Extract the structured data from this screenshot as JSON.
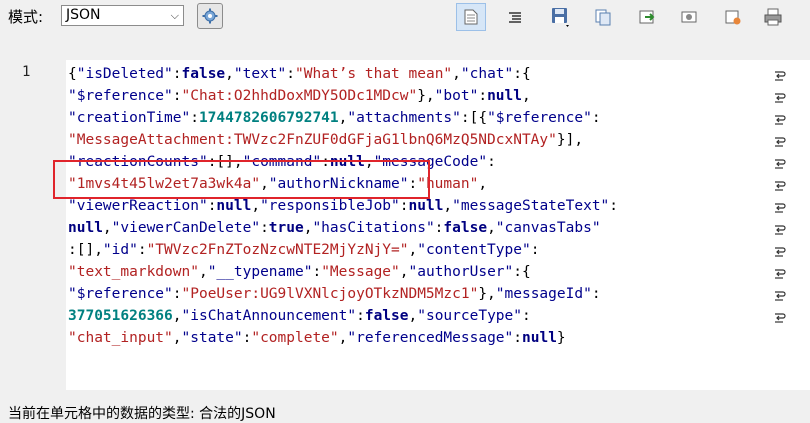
{
  "toolbar": {
    "mode_label": "模式:",
    "mode_value": "JSON",
    "buttons": [
      "format-icon",
      "compact-icon",
      "save-icon",
      "copy-icon",
      "export-icon",
      "image-icon",
      "record-icon",
      "print-icon"
    ]
  },
  "editor": {
    "line_number": "1",
    "lines": [
      [
        [
          "p",
          "{"
        ],
        [
          "k",
          "\"isDeleted\""
        ],
        [
          "p",
          ":"
        ],
        [
          "kw",
          "false"
        ],
        [
          "p",
          ","
        ],
        [
          "k",
          "\"text\""
        ],
        [
          "p",
          ":"
        ],
        [
          "s",
          "\"What’s that mean\""
        ],
        [
          "p",
          ","
        ],
        [
          "k",
          "\"chat\""
        ],
        [
          "p",
          ":{"
        ]
      ],
      [
        [
          "k",
          "\"$reference\""
        ],
        [
          "p",
          ":"
        ],
        [
          "s",
          "\"Chat:O2hhdDoxMDY5ODc1MDcw\""
        ],
        [
          "p",
          "},"
        ],
        [
          "k",
          "\"bot\""
        ],
        [
          "p",
          ":"
        ],
        [
          "kw",
          "null"
        ],
        [
          "p",
          ","
        ]
      ],
      [
        [
          "k",
          "\"creationTime\""
        ],
        [
          "p",
          ":"
        ],
        [
          "n",
          "1744782606792741"
        ],
        [
          "p",
          ","
        ],
        [
          "k",
          "\"attachments\""
        ],
        [
          "p",
          ":[{"
        ],
        [
          "k",
          "\"$reference\""
        ],
        [
          "p",
          ":"
        ]
      ],
      [
        [
          "s",
          "\"MessageAttachment:TWVzc2FnZUF0dGFjaG1lbnQ6MzQ5NDcxNTAy\""
        ],
        [
          "p",
          "}],"
        ]
      ],
      [
        [
          "k",
          "\"reactionCounts\""
        ],
        [
          "p",
          ":[],"
        ],
        [
          "k",
          "\"command\""
        ],
        [
          "p",
          ":"
        ],
        [
          "kw",
          "null"
        ],
        [
          "p",
          ","
        ],
        [
          "k",
          "\"messageCode\""
        ],
        [
          "p",
          ":"
        ]
      ],
      [
        [
          "s",
          "\"1mvs4t45lw2et7a3wk4a\""
        ],
        [
          "p",
          ","
        ],
        [
          "k",
          "\"authorNickname\""
        ],
        [
          "p",
          ":"
        ],
        [
          "s",
          "\"human\""
        ],
        [
          "p",
          ","
        ]
      ],
      [
        [
          "k",
          "\"viewerReaction\""
        ],
        [
          "p",
          ":"
        ],
        [
          "kw",
          "null"
        ],
        [
          "p",
          ","
        ],
        [
          "k",
          "\"responsibleJob\""
        ],
        [
          "p",
          ":"
        ],
        [
          "kw",
          "null"
        ],
        [
          "p",
          ","
        ],
        [
          "k",
          "\"messageStateText\""
        ],
        [
          "p",
          ":"
        ]
      ],
      [
        [
          "kw",
          "null"
        ],
        [
          "p",
          ","
        ],
        [
          "k",
          "\"viewerCanDelete\""
        ],
        [
          "p",
          ":"
        ],
        [
          "kw",
          "true"
        ],
        [
          "p",
          ","
        ],
        [
          "k",
          "\"hasCitations\""
        ],
        [
          "p",
          ":"
        ],
        [
          "kw",
          "false"
        ],
        [
          "p",
          ","
        ],
        [
          "k",
          "\"canvasTabs\""
        ]
      ],
      [
        [
          "p",
          ":[],"
        ],
        [
          "k",
          "\"id\""
        ],
        [
          "p",
          ":"
        ],
        [
          "s",
          "\"TWVzc2FnZTozNzcwNTE2MjYzNjY=\""
        ],
        [
          "p",
          ","
        ],
        [
          "k",
          "\"contentType\""
        ],
        [
          "p",
          ":"
        ]
      ],
      [
        [
          "s",
          "\"text_markdown\""
        ],
        [
          "p",
          ","
        ],
        [
          "k",
          "\"__typename\""
        ],
        [
          "p",
          ":"
        ],
        [
          "s",
          "\"Message\""
        ],
        [
          "p",
          ","
        ],
        [
          "k",
          "\"authorUser\""
        ],
        [
          "p",
          ":{"
        ]
      ],
      [
        [
          "k",
          "\"$reference\""
        ],
        [
          "p",
          ":"
        ],
        [
          "s",
          "\"PoeUser:UG9lVXNlcjoyOTkzNDM5Mzc1\""
        ],
        [
          "p",
          "},"
        ],
        [
          "k",
          "\"messageId\""
        ],
        [
          "p",
          ":"
        ]
      ],
      [
        [
          "n",
          "377051626366"
        ],
        [
          "p",
          ","
        ],
        [
          "k",
          "\"isChatAnnouncement\""
        ],
        [
          "p",
          ":"
        ],
        [
          "kw",
          "false"
        ],
        [
          "p",
          ","
        ],
        [
          "k",
          "\"sourceType\""
        ],
        [
          "p",
          ":"
        ]
      ],
      [
        [
          "s",
          "\"chat_input\""
        ],
        [
          "p",
          ","
        ],
        [
          "k",
          "\"state\""
        ],
        [
          "p",
          ":"
        ],
        [
          "s",
          "\"complete\""
        ],
        [
          "p",
          ","
        ],
        [
          "k",
          "\"referencedMessage\""
        ],
        [
          "p",
          ":"
        ],
        [
          "kw",
          "null"
        ],
        [
          "p",
          "}"
        ]
      ]
    ]
  },
  "status": {
    "text": "当前在单元格中的数据的类型: 合法的JSON"
  },
  "colors": {
    "key": "#00008b",
    "string": "#b22222",
    "number": "#008080",
    "keyword": "#000080",
    "highlight_border": "#e0242b"
  }
}
